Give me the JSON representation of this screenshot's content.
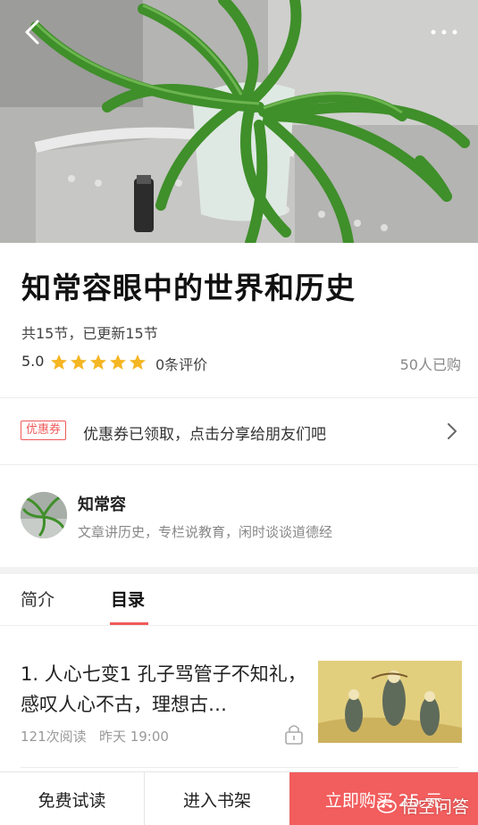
{
  "header": {
    "back_icon": "chevron-left-icon",
    "more_icon": "more-horizontal-icon"
  },
  "course": {
    "title": "知常容眼中的世界和历史",
    "sections_text": "共15节，已更新15节",
    "rating": "5.0",
    "stars": 5,
    "star_color": "#f5b623",
    "reviews": "0条评价",
    "buyers": "50人已购"
  },
  "coupon": {
    "tag": "优惠券",
    "text": "优惠券已领取，点击分享给朋友们吧",
    "accent": "#f05a5a"
  },
  "author": {
    "name": "知常容",
    "description": "文章讲历史，专栏说教育，闲时谈谈道德经"
  },
  "tabs": [
    {
      "label": "简介",
      "active": false
    },
    {
      "label": "目录",
      "active": true
    }
  ],
  "articles": [
    {
      "title": "1. 人心七变1 孔子骂管子不知礼，感叹人心不古，理想古…",
      "reads": "121次阅读",
      "time": "昨天 19:00",
      "locked": true
    }
  ],
  "bottom_bar": {
    "trial": "免费试读",
    "shelf": "进入书架",
    "buy": "立即购买 25 元",
    "buy_color": "#f25d5d"
  },
  "watermark": {
    "text": "悟空问答"
  }
}
